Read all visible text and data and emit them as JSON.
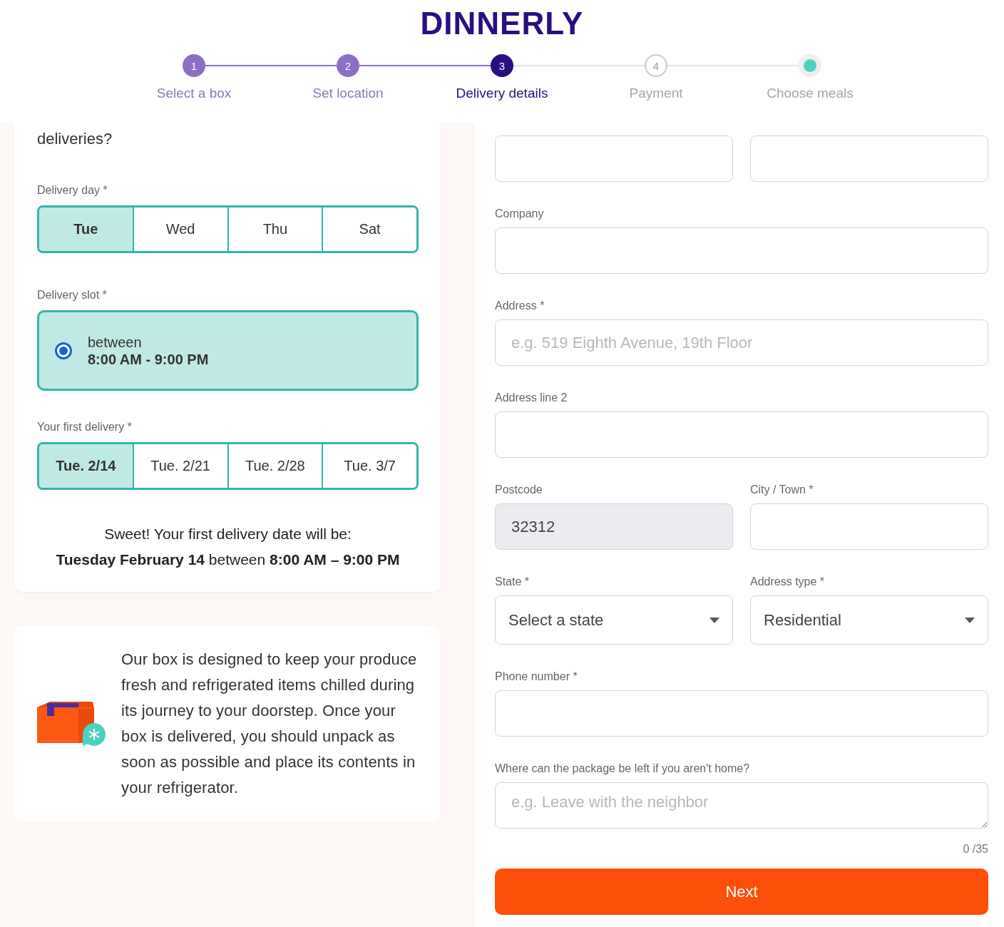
{
  "logo": "DINNERLY",
  "steps": [
    {
      "number": "1",
      "label": "Select a box",
      "done": true,
      "current": false,
      "kind": "number"
    },
    {
      "number": "2",
      "label": "Set location",
      "done": true,
      "current": false,
      "kind": "number"
    },
    {
      "number": "3",
      "label": "Delivery details",
      "done": false,
      "current": true,
      "kind": "number"
    },
    {
      "number": "4",
      "label": "Payment",
      "done": false,
      "current": false,
      "kind": "number"
    },
    {
      "label": "Choose meals",
      "done": false,
      "current": false,
      "kind": "dot"
    }
  ],
  "delivery_card": {
    "heading": "deliveries?",
    "day_label": "Delivery day *",
    "days": [
      {
        "label": "Tue",
        "selected": true
      },
      {
        "label": "Wed",
        "selected": false
      },
      {
        "label": "Thu",
        "selected": false
      },
      {
        "label": "Sat",
        "selected": false
      }
    ],
    "slot_label": "Delivery slot *",
    "slots": [
      {
        "prefix": "between",
        "time": "8:00 AM - 9:00 PM",
        "selected": true
      }
    ],
    "first_label": "Your first delivery *",
    "dates": [
      {
        "label": "Tue. 2/14",
        "selected": true
      },
      {
        "label": "Tue. 2/21",
        "selected": false
      },
      {
        "label": "Tue. 2/28",
        "selected": false
      },
      {
        "label": "Tue. 3/7",
        "selected": false
      }
    ],
    "message": "Sweet! Your first delivery date will be:",
    "summary": "**Tuesday February 14** between **8:00 AM – 9:00 PM**"
  },
  "info_card": {
    "text": "Our box is designed to keep your produce fresh and refrigerated items chilled during its journey to your doorstep. Once your box is delivered, you should unpack as soon as possible and place its contents in your refrigerator."
  },
  "form_rows": [
    [
      {
        "kind": "input"
      },
      {
        "kind": "input"
      }
    ],
    [
      {
        "kind": "input",
        "label": "Company"
      }
    ],
    [
      {
        "kind": "input",
        "label": "Address *",
        "placeholder": "e.g. 519 Eighth Avenue, 19th Floor"
      }
    ],
    [
      {
        "kind": "input",
        "label": "Address line 2"
      }
    ],
    [
      {
        "kind": "input",
        "label": "Postcode",
        "value": "32312",
        "disabled": true
      },
      {
        "kind": "input",
        "label": "City / Town *"
      }
    ],
    [
      {
        "kind": "select",
        "label": "State *",
        "value": "Select a state"
      },
      {
        "kind": "select",
        "label": "Address type *",
        "value": "Residential"
      }
    ],
    [
      {
        "kind": "input",
        "label": "Phone number *"
      }
    ],
    [
      {
        "kind": "textarea",
        "label": "Where can the package be left if you aren't home?",
        "placeholder": "e.g. Leave with the neighbor",
        "counter": "0 /35"
      }
    ]
  ],
  "next_button": "Next"
}
